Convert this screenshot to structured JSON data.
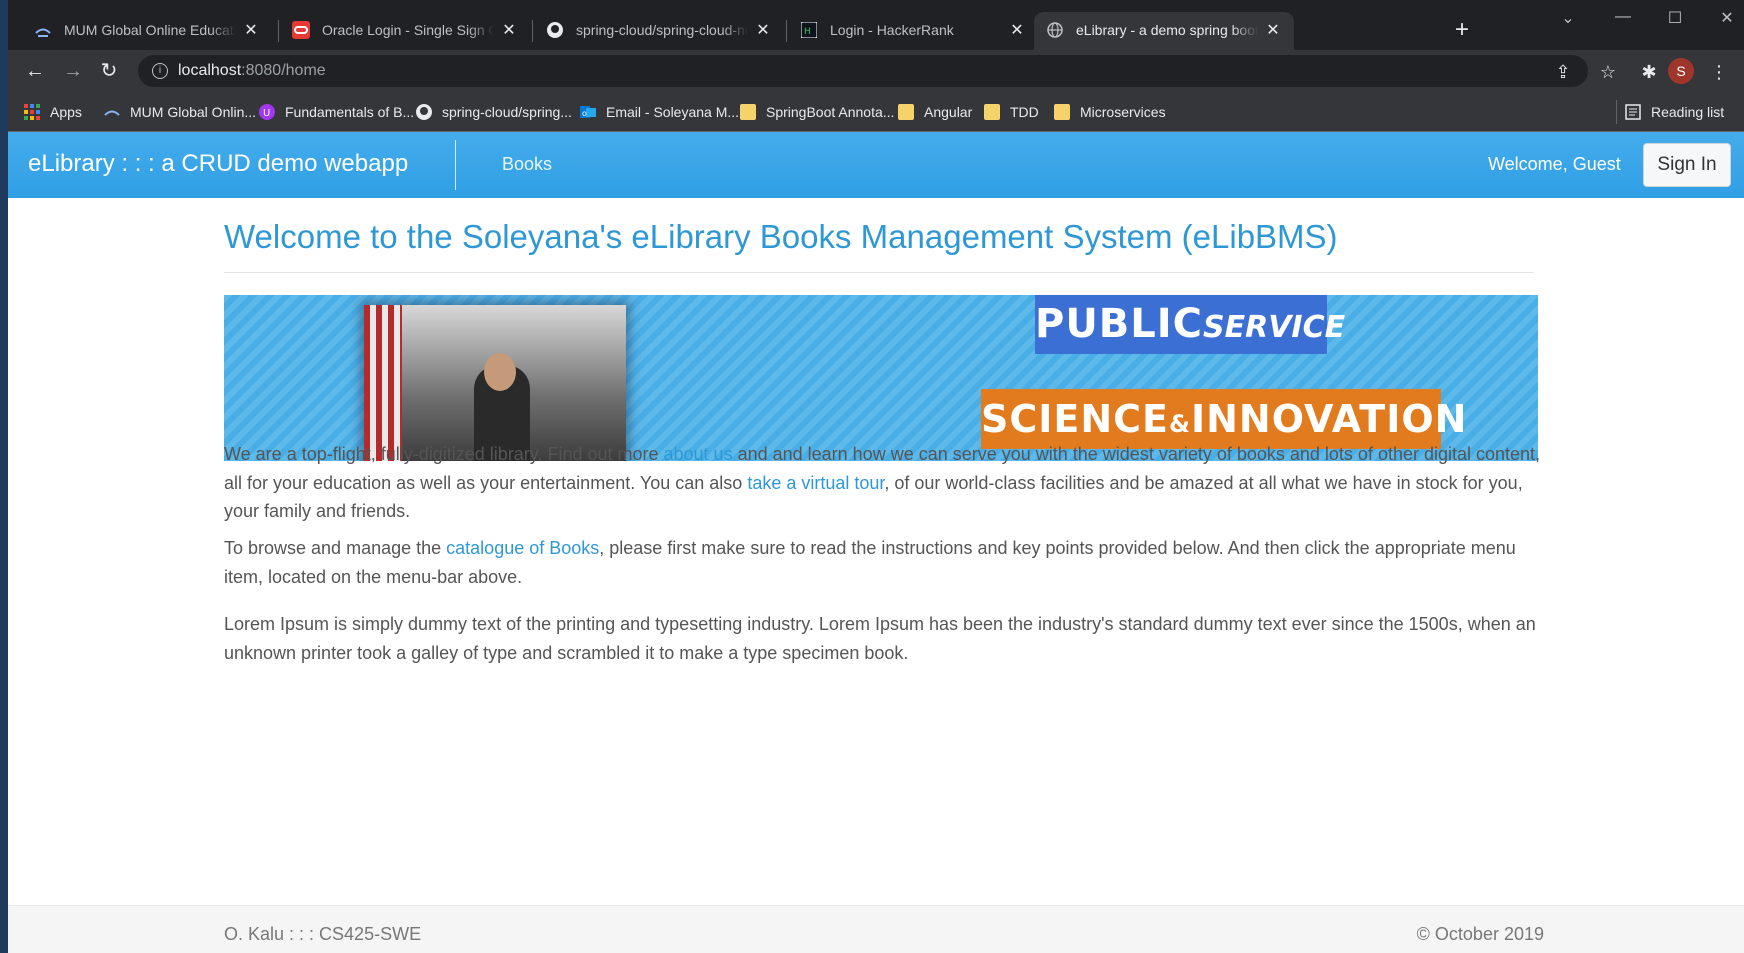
{
  "tabs": [
    {
      "title": "MUM Global Online Education : C",
      "active": false
    },
    {
      "title": "Oracle Login - Single Sign On",
      "active": false
    },
    {
      "title": "spring-cloud/spring-cloud-netflix",
      "active": false
    },
    {
      "title": "Login - HackerRank",
      "active": false
    },
    {
      "title": "eLibrary - a demo spring boot web",
      "active": true
    }
  ],
  "toolbar": {
    "url_host": "localhost",
    "url_path": ":8080/home",
    "avatar_letter": "S"
  },
  "bookmarks": {
    "apps": "Apps",
    "items": [
      "MUM Global Onlin...",
      "Fundamentals of B...",
      "spring-cloud/spring...",
      "Email - Soleyana M...",
      "SpringBoot Annota...",
      "Angular",
      "TDD",
      "Microservices"
    ],
    "reading_list": "Reading list"
  },
  "app": {
    "brand": "eLibrary : : : a CRUD demo webapp",
    "nav_books": "Books",
    "welcome": "Welcome, Guest",
    "signin": "Sign In"
  },
  "main": {
    "heading": "Welcome to the Soleyana's eLibrary Books Management System (eLibBMS)",
    "banner": {
      "public": "PUBLIC",
      "service": "SERVICE",
      "science": "SCIENCE",
      "amp": "&",
      "innovation": "INNOVATION"
    },
    "p1_a": "We are a top-flight, fully-digitized library. Find out more ",
    "p1_link1": "about us",
    "p1_b": " and and learn how we can serve you with the widest variety of books and lots of other digital content, all for your education as well as your entertainment. You can also ",
    "p1_link2": "take a virtual tour",
    "p1_c": ", of our world-class facilities and be amazed at all what we have in stock for you, your family and friends.",
    "p2_a": "To browse and manage the ",
    "p2_link": "catalogue of Books",
    "p2_b": ", please first make sure to read the instructions and key points provided below. And then click the appropriate menu item, located on the menu-bar above.",
    "p3": "Lorem Ipsum is simply dummy text of the printing and typesetting industry. Lorem Ipsum has been the industry's standard dummy text ever since the 1500s, when an unknown printer took a galley of type and scrambled it to make a type specimen book."
  },
  "footer": {
    "left": "O. Kalu : : : CS425-SWE",
    "right": "© October 2019"
  }
}
